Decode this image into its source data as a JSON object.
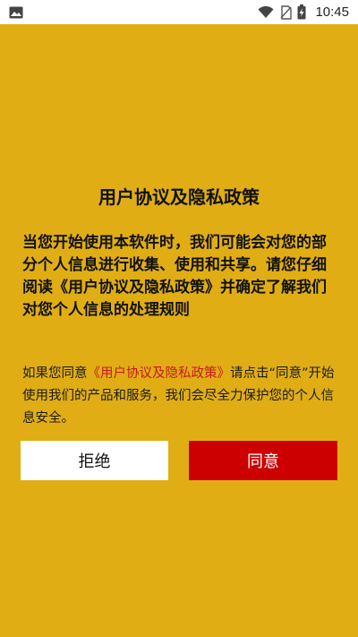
{
  "status_bar": {
    "time": "10:45",
    "icons": [
      "image-icon",
      "wifi-icon",
      "sim-icon",
      "battery-charging-icon"
    ]
  },
  "dialog": {
    "title": "用户协议及隐私政策",
    "summary": "当您开始使用本软件时，我们可能会对您的部分个人信息进行收集、使用和共享。请您仔细阅读《用户协议及隐私政策》并确定了解我们对您个人信息的处理规则",
    "notice_prefix": "如果您同意",
    "notice_link": "《用户协议及隐私政策》",
    "notice_suffix": "请点击“同意”开始使用我们的产品和服务，我们会尽全力保护您的个人信息安全。",
    "reject_label": "拒绝",
    "agree_label": "同意"
  },
  "colors": {
    "background": "#E0AE14",
    "agree_button": "#CC0000",
    "link": "#C8181E"
  }
}
